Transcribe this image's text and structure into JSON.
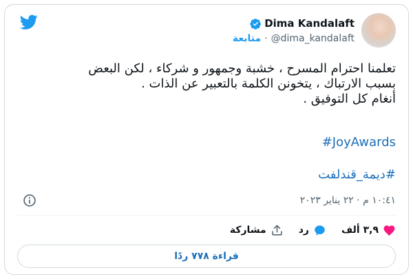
{
  "author": {
    "display_name": "Dima Kandalaft",
    "handle": "@dima_kandalaft",
    "follow_label": "متابعة",
    "separator": "·"
  },
  "tweet": {
    "lines": [
      "تعلمنا احترام المسرح ، خشبة وجمهور و شركاء ، لكن البعض",
      "بسبب الارتباك ، يتخونن الكلمة بالتعبير عن الذات .",
      "أنغام كل التوفيق ."
    ],
    "hashtags": [
      "#JoyAwards",
      "#ديمة_قندلفت"
    ]
  },
  "meta": {
    "timestamp": "١٠:٤١ م · ٢٢ يناير ٢٠٢٣"
  },
  "actions": {
    "like_count": "٣,٩ ألف",
    "reply_label": "رد",
    "share_label": "مشاركة"
  },
  "replies_button_label": "قراءة ٧٧٨ ردًا",
  "colors": {
    "brand_blue": "#1d9bf0",
    "link_blue": "#1d6fb8",
    "heart_pink": "#f91880",
    "text": "#0f1419",
    "muted": "#536471",
    "border": "#cfd9de"
  },
  "icons": [
    "twitter-bird-icon",
    "verified-badge-icon",
    "info-icon",
    "heart-icon",
    "reply-icon",
    "share-icon"
  ]
}
